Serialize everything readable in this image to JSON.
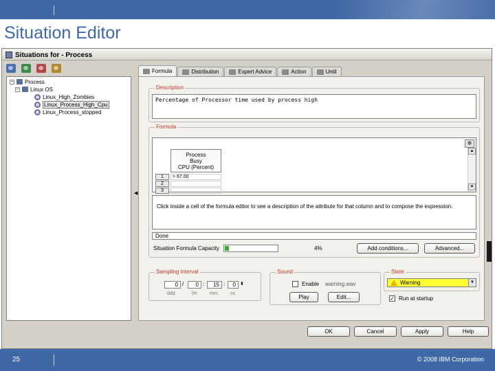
{
  "slide": {
    "title": "Situation Editor",
    "page_number": "25",
    "copyright": "© 2008 IBM Corporation"
  },
  "window": {
    "title": "Situations for - Process"
  },
  "toolbar": {
    "icons": [
      "new-situation-icon",
      "create-another-icon",
      "delete-icon",
      "edit-icon"
    ]
  },
  "tree": {
    "root": "Process",
    "group": "Linux OS",
    "items": [
      "Linux_High_Zombies",
      "Linux_Process_High_Cpu",
      "Linux_Process_stopped"
    ],
    "selected": "Linux_Process_High_Cpu"
  },
  "tabs": [
    {
      "label": "Formula",
      "icon": "formula-icon",
      "active": true
    },
    {
      "label": "Distribution",
      "icon": "distribution-icon",
      "active": false
    },
    {
      "label": "Expert Advice",
      "icon": "expert-advice-icon",
      "active": false
    },
    {
      "label": "Action",
      "icon": "action-icon",
      "active": false
    },
    {
      "label": "Until",
      "icon": "until-icon",
      "active": false
    }
  ],
  "description": {
    "label": "Description",
    "text": "Percentage of Processor time used by process high"
  },
  "formula": {
    "label": "Formula",
    "column_header": [
      "Process",
      "Busy",
      "CPU (Percent)"
    ],
    "rows": [
      {
        "num": "1",
        "value": "> 67.00"
      },
      {
        "num": "2",
        "value": ""
      },
      {
        "num": "3",
        "value": ""
      }
    ],
    "hint": "Click inside a cell of the formula editor to see a description of the attribute for that column and to compose the expression.",
    "status": "Done",
    "capacity_label": "Situation Formula Capacity",
    "capacity_percent": "4%",
    "capacity_fraction": 0.04,
    "add_conditions_button": "Add conditions...",
    "advanced_button": "Advanced..."
  },
  "sampling": {
    "label": "Sampling interval",
    "values": [
      "0",
      "0",
      "15",
      "0"
    ],
    "units": [
      "ddd",
      "hh",
      "mm",
      "ss"
    ]
  },
  "sound": {
    "label": "Sound",
    "enable_label": "Enable",
    "file": "warning.wav",
    "enabled": false,
    "play_button": "Play",
    "edit_button": "Edit..."
  },
  "state": {
    "label": "State",
    "value": "Warning",
    "color": "#ffff33",
    "run_at_startup_label": "Run at startup",
    "run_at_startup": true
  },
  "buttons": {
    "ok": "OK",
    "cancel": "Cancel",
    "apply": "Apply",
    "help": "Help"
  },
  "colors": {
    "slide_blue": "#3f68a6",
    "group_label": "#c0392b",
    "meter_fill": "#33b233"
  }
}
